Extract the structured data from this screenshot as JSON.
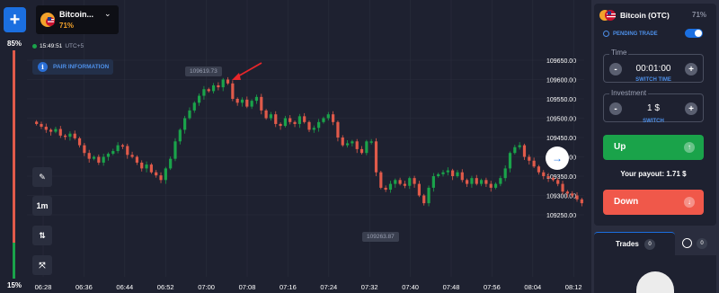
{
  "asset_tab": {
    "name": "Bitcoin...",
    "payout_pct": "71%",
    "chevron_icon": "chevron-down-icon"
  },
  "add_button": {
    "label": "+"
  },
  "sentiment": {
    "top_pct": "85%",
    "bottom_pct": "15%",
    "up_fraction": 0.15,
    "down_fraction": 0.85
  },
  "clock": {
    "time": "15:49:51",
    "timezone": "UTC+5"
  },
  "pair_info": {
    "label": "PAIR INFORMATION",
    "icon": "info-icon"
  },
  "tools": [
    {
      "name": "draw-tool-button",
      "icon": "pencil-icon",
      "label": "✎"
    },
    {
      "name": "timeframe-button",
      "icon": "",
      "label": "1m"
    },
    {
      "name": "chart-type-button",
      "icon": "candles-icon",
      "label": "⇅"
    },
    {
      "name": "indicators-button",
      "icon": "indicator-icon",
      "label": "⤧"
    }
  ],
  "chart": {
    "y_labels": [
      "109650.00",
      "109600.00",
      "109550.00",
      "109500.00",
      "109450.00",
      "109400.00",
      "109350.00",
      "109300.00",
      "109250.00"
    ],
    "x_labels": [
      "06:28",
      "06:36",
      "06:44",
      "06:52",
      "07:00",
      "07:08",
      "07:16",
      "07:24",
      "07:32",
      "07:40",
      "07:48",
      "07:56",
      "08:04",
      "08:12"
    ],
    "high_tag": "109619.73",
    "low_tag": "109263.87",
    "colors": {
      "up": "#1aa34a",
      "down": "#e05a4a",
      "grid": "#2a2e3d",
      "annotation": "#e8262a"
    }
  },
  "chart_data": {
    "type": "candlestick",
    "ylim": [
      109230,
      109670
    ],
    "x_axis": [
      "06:28",
      "06:36",
      "06:44",
      "06:52",
      "07:00",
      "07:08",
      "07:16",
      "07:24",
      "07:32",
      "07:40",
      "07:48",
      "07:56",
      "08:04",
      "08:12"
    ],
    "high_label": 109619.73,
    "low_label": 109263.87,
    "close_path": [
      109485,
      109478,
      109470,
      109465,
      109472,
      109455,
      109452,
      109460,
      109448,
      109430,
      109410,
      109395,
      109400,
      109385,
      109400,
      109408,
      109415,
      109430,
      109428,
      109405,
      109400,
      109385,
      109370,
      109380,
      109360,
      109352,
      109340,
      109370,
      109395,
      109440,
      109470,
      109500,
      109520,
      109540,
      109558,
      109575,
      109570,
      109585,
      109580,
      109600,
      109590,
      109550,
      109540,
      109548,
      109530,
      109545,
      109555,
      109520,
      109500,
      109510,
      109485,
      109480,
      109500,
      109490,
      109485,
      109505,
      109490,
      109470,
      109475,
      109490,
      109500,
      109510,
      109490,
      109450,
      109430,
      109435,
      109440,
      109420,
      109410,
      109440,
      109440,
      109360,
      109320,
      109315,
      109330,
      109340,
      109330,
      109325,
      109345,
      109330,
      109300,
      109280,
      109320,
      109350,
      109355,
      109360,
      109365,
      109350,
      109360,
      109340,
      109330,
      109345,
      109330,
      109340,
      109330,
      109320,
      109330,
      109345,
      109370,
      109410,
      109425,
      109430,
      109400,
      109390,
      109375,
      109360,
      109350,
      109345,
      109340,
      109330,
      109310,
      109305,
      109300,
      109290,
      109280
    ]
  },
  "expand_arrow": {
    "icon": "arrow-right-icon",
    "label": "→"
  },
  "panel": {
    "asset_name": "Bitcoin (OTC)",
    "asset_pct": "71%",
    "pending_trade": "PENDING TRADE",
    "time": {
      "label": "Time",
      "value": "00:01:00",
      "switch": "SWITCH TIME"
    },
    "investment": {
      "label": "Investment",
      "value": "1 $",
      "switch": "SWITCH"
    },
    "up_label": "Up",
    "payout": "Your payout: 1.71 $",
    "down_label": "Down",
    "trades_label": "Trades",
    "trades_count": "0",
    "history_count": "0",
    "minus": "-",
    "plus": "+",
    "up_icon": "arrow-up-icon",
    "down_icon": "arrow-down-icon"
  }
}
